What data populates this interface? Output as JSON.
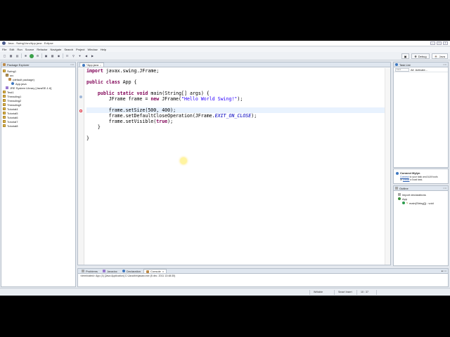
{
  "window": {
    "title": "Java - Swing1/src/App.java - Eclipse",
    "controls": [
      "–",
      "□",
      "×"
    ]
  },
  "menu": [
    "File",
    "Edit",
    "Run",
    "Source",
    "Refactor",
    "Navigate",
    "Search",
    "Project",
    "Window",
    "Help"
  ],
  "perspectives": {
    "debug": "Debug",
    "java": "Java"
  },
  "package_explorer": {
    "tab": "Package Explorer",
    "tree": [
      {
        "label": "Swing1",
        "indent": 0,
        "icon": "project-icon"
      },
      {
        "label": "src",
        "indent": 1,
        "icon": "source-folder-icon"
      },
      {
        "label": "(default package)",
        "indent": 2,
        "icon": "package-icon"
      },
      {
        "label": "App.java",
        "indent": 3,
        "icon": "java-file-icon"
      },
      {
        "label": "JRE System Library [JavaSE-1.6]",
        "indent": 1,
        "icon": "library-icon"
      },
      {
        "label": "Test1",
        "indent": 0,
        "icon": "project-icon"
      },
      {
        "label": "Threading1",
        "indent": 0,
        "icon": "project-icon"
      },
      {
        "label": "Threading2",
        "indent": 0,
        "icon": "project-icon"
      },
      {
        "label": "Threading3",
        "indent": 0,
        "icon": "project-icon"
      },
      {
        "label": "Tutorial4",
        "indent": 0,
        "icon": "project-icon"
      },
      {
        "label": "Tutorial5",
        "indent": 0,
        "icon": "project-icon"
      },
      {
        "label": "Tutorial6",
        "indent": 0,
        "icon": "project-icon"
      },
      {
        "label": "Tutorial7",
        "indent": 0,
        "icon": "project-icon"
      },
      {
        "label": "Tutorial8",
        "indent": 0,
        "icon": "project-icon"
      }
    ]
  },
  "editor": {
    "tab": "*App.java",
    "code": {
      "l1_kw": "import",
      "l1_rest": " javax.swing.JFrame;",
      "l3_kw1": "public",
      "l3_kw2": "class",
      "l3_rest": " App {",
      "l5_kw1": "public",
      "l5_kw2": "static",
      "l5_kw3": "void",
      "l5_rest": " main(String[] args) {",
      "l6_a": "JFrame frame = ",
      "l6_kw": "new",
      "l6_b": " JFrame(",
      "l6_str": "\"Hello World Swing!\"",
      "l6_c": ");",
      "l8": "frame.setSize(500, 400);",
      "l9_a": "frame.setDefaultCloseOperation(JFrame.",
      "l9_const": "EXIT_ON_CLOSE",
      "l9_b": ");",
      "l10_a": "frame.setVisible(",
      "l10_kw": "true",
      "l10_b": ");",
      "l11": "}",
      "l12": "}"
    }
  },
  "task_list": {
    "tab": "Task List",
    "find_placeholder": "Find",
    "all": "All",
    "activate": "Activate...",
    "mylyn_title": "Connect Mylyn",
    "mylyn_link1": "Connect",
    "mylyn_text1": " to your task and ALM tools",
    "mylyn_text2": "or ",
    "mylyn_link2": "create",
    "mylyn_text3": " a local task."
  },
  "outline": {
    "tab": "Outline",
    "imports": "import declarations",
    "class": "App",
    "method": "main(String[]) : void"
  },
  "bottom_tabs": [
    "Problems",
    "Javadoc",
    "Declaration",
    "Console"
  ],
  "console": {
    "output": "<terminated> App (4) [Java Application] C:\\Java\\bin\\javaw.exe (8 dec. 2011 13:48:35)"
  },
  "status": {
    "writable": "Writable",
    "insert": "Smart Insert",
    "position": "10 : 37"
  }
}
